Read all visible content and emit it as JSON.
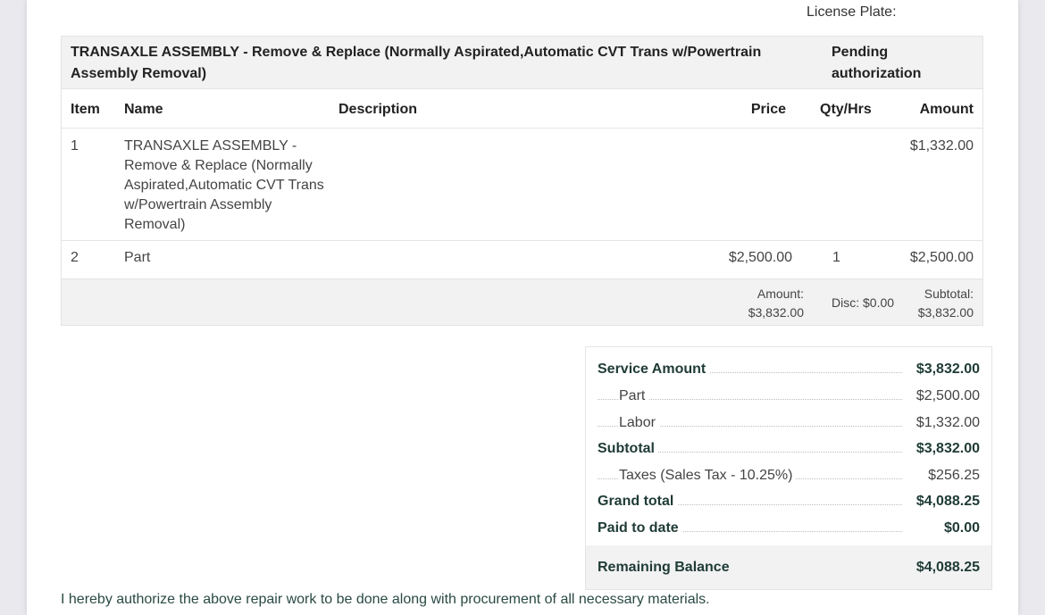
{
  "header": {
    "license_plate_label": "License Plate:"
  },
  "job": {
    "title": "TRANSAXLE ASSEMBLY - Remove & Replace (Normally Aspirated,Automatic CVT Trans w/Powertrain Assembly Removal)",
    "status": "Pending authorization",
    "columns": {
      "item": "Item",
      "name": "Name",
      "description": "Description",
      "price": "Price",
      "qty": "Qty/Hrs",
      "amount": "Amount"
    },
    "rows": [
      {
        "item": "1",
        "name": "TRANSAXLE ASSEMBLY - Remove & Replace (Normally Aspirated,Automatic CVT Trans w/Powertrain Assembly Removal)",
        "description": "",
        "price": "",
        "qty": "",
        "amount": "$1,332.00"
      },
      {
        "item": "2",
        "name": "Part",
        "description": "",
        "price": "$2,500.00",
        "qty": "1",
        "amount": "$2,500.00"
      }
    ],
    "totals": {
      "amount_label": "Amount:",
      "amount_value": "$3,832.00",
      "disc": "Disc: $0.00",
      "subtotal_label": "Subtotal:",
      "subtotal_value": "$3,832.00"
    }
  },
  "summary": {
    "service_amount_label": "Service Amount",
    "service_amount_value": "$3,832.00",
    "part_label": "Part",
    "part_value": "$2,500.00",
    "labor_label": "Labor",
    "labor_value": "$1,332.00",
    "subtotal_label": "Subtotal",
    "subtotal_value": "$3,832.00",
    "taxes_label": "Taxes (Sales Tax - 10.25%)",
    "taxes_value": "$256.25",
    "grand_total_label": "Grand total",
    "grand_total_value": "$4,088.25",
    "paid_label": "Paid to date",
    "paid_value": "$0.00",
    "remaining_label": "Remaining Balance",
    "remaining_value": "$4,088.25"
  },
  "authorization_text": "I hereby authorize the above repair work to be done along with procurement of all necessary materials.",
  "colors": {
    "accent_text": "#1f3b36",
    "header_bg": "#f2f2f2",
    "border": "#e4e4e4"
  }
}
